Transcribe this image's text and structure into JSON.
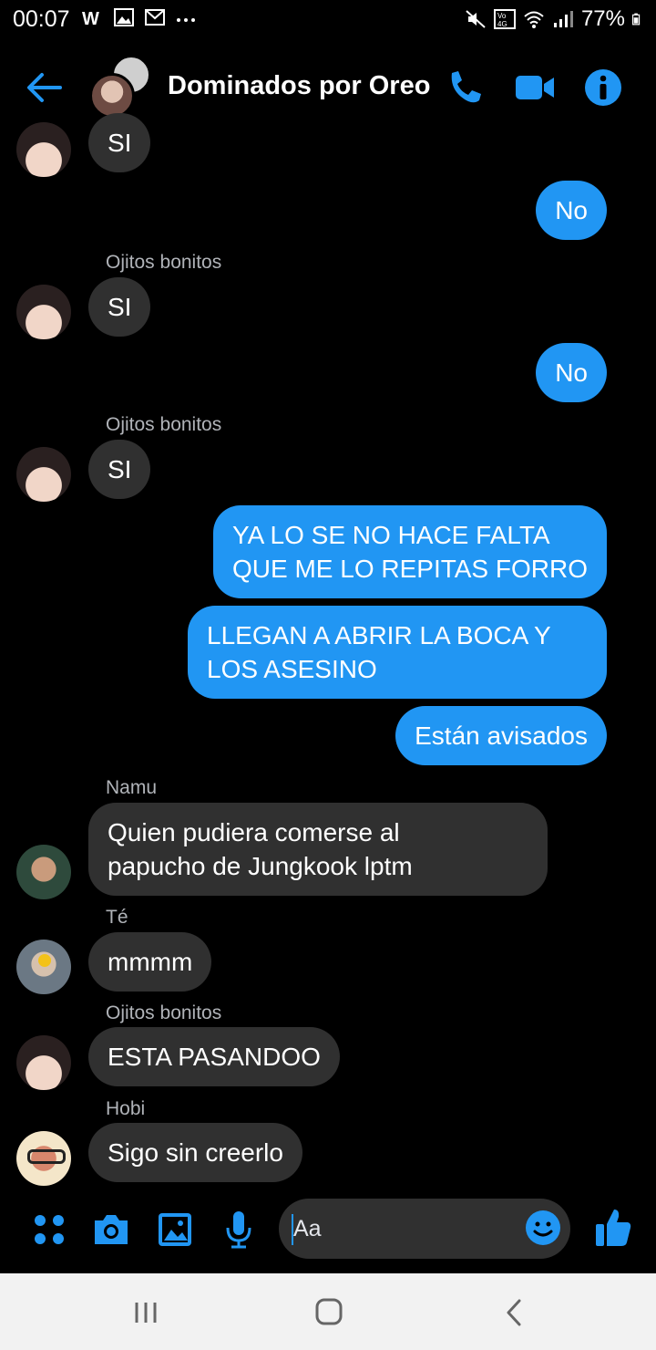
{
  "status_bar": {
    "time": "00:07",
    "battery": "77%",
    "left_icons": [
      "whatsapp-icon",
      "gallery-icon",
      "gmail-icon",
      "more-icon"
    ],
    "right_icons": [
      "mute-icon",
      "volte-icon",
      "wifi-icon",
      "signal-icon",
      "battery-icon"
    ]
  },
  "header": {
    "title": "Dominados por Oreo",
    "actions": [
      "phone-icon",
      "video-icon",
      "info-icon"
    ]
  },
  "messages": [
    {
      "dir": "in",
      "sender": "",
      "text": "SI",
      "avatar": "ojitos"
    },
    {
      "dir": "out",
      "text": "No"
    },
    {
      "dir": "in",
      "sender": "Ojitos bonitos",
      "text": "SI",
      "avatar": "ojitos"
    },
    {
      "dir": "out",
      "text": "No"
    },
    {
      "dir": "in",
      "sender": "Ojitos bonitos",
      "text": "SI",
      "avatar": "ojitos"
    },
    {
      "dir": "out",
      "text_lines": [
        "YA LO SE NO HACE FALTA",
        "QUE ME LO REPITAS FORRO"
      ]
    },
    {
      "dir": "out",
      "text_lines": [
        "LLEGAN A ABRIR LA BOCA Y",
        "LOS ASESINO"
      ]
    },
    {
      "dir": "out",
      "text": "Están avisados"
    },
    {
      "dir": "in",
      "sender": "Namu",
      "text_lines": [
        "Quien pudiera comerse al",
        "papucho de Jungkook lptm"
      ],
      "avatar": "namu"
    },
    {
      "dir": "in",
      "sender": "Té",
      "text": "mmmm",
      "avatar": "te"
    },
    {
      "dir": "in",
      "sender": "Ojitos bonitos",
      "text": "ESTA PASANDOO",
      "avatar": "ojitos"
    },
    {
      "dir": "in",
      "sender": "Hobi",
      "text": "Sigo sin creerlo",
      "avatar": "hobi"
    }
  ],
  "composer": {
    "placeholder": "Aa",
    "icons": [
      "apps-icon",
      "camera-icon",
      "image-icon",
      "mic-icon",
      "emoji-icon",
      "like-icon"
    ]
  },
  "colors": {
    "accent": "#2196f3",
    "incoming_bubble": "#303030",
    "background": "#000000",
    "sender_label": "#b0b3b8"
  },
  "nav_bar": [
    "recents-icon",
    "home-icon",
    "back-icon"
  ]
}
